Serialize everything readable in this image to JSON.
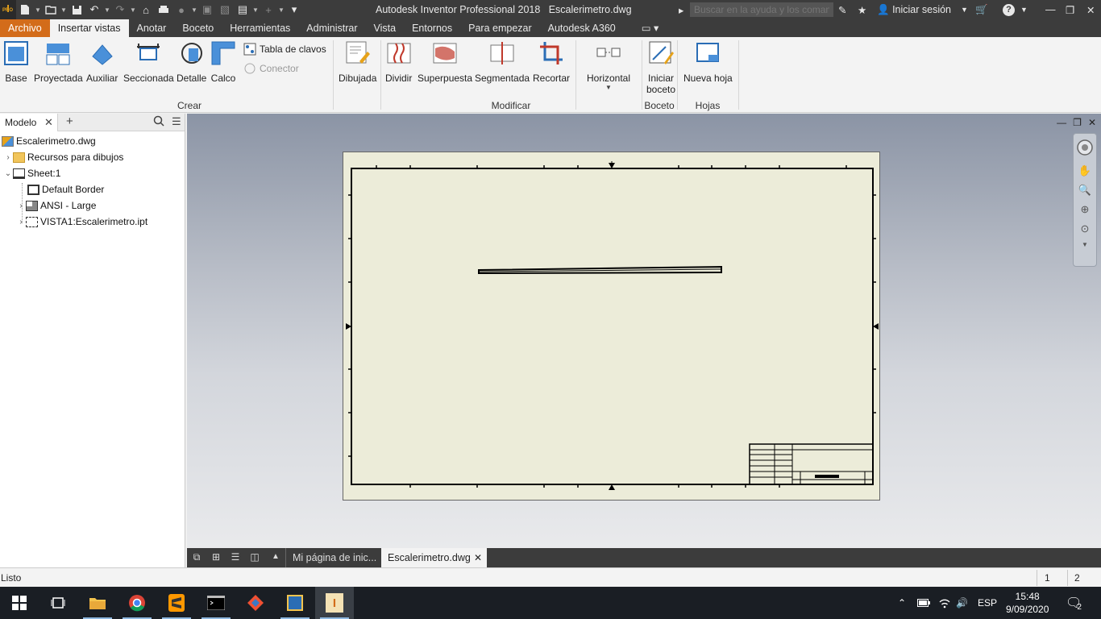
{
  "app": {
    "title": "Autodesk Inventor Professional 2018",
    "document": "Escalerimetro.dwg",
    "logo_letters": "I",
    "logo_edition": "PRO"
  },
  "titlebar": {
    "search_placeholder": "Buscar en la ayuda y los comandos",
    "signin_label": "Iniciar sesión"
  },
  "ribbon_tabs": [
    "Archivo",
    "Insertar vistas",
    "Anotar",
    "Boceto",
    "Herramientas",
    "Administrar",
    "Vista",
    "Entornos",
    "Para empezar",
    "Autodesk A360"
  ],
  "ribbon": {
    "crear": {
      "label": "Crear",
      "buttons": [
        "Base",
        "Proyectada",
        "Auxiliar",
        "Seccionada",
        "Detalle",
        "Calco"
      ],
      "small": [
        "Tabla de clavos",
        "Conector"
      ]
    },
    "modificar": {
      "label": "Modificar",
      "buttons": [
        "Dibujada",
        "Dividir",
        "Superpuesta",
        "Segmentada",
        "Recortar",
        "Horizontal"
      ]
    },
    "boceto": {
      "label": "Boceto",
      "button_line1": "Iniciar",
      "button_line2": "boceto"
    },
    "hojas": {
      "label": "Hojas",
      "button": "Nueva hoja"
    }
  },
  "browser": {
    "tab_label": "Modelo",
    "tree": [
      {
        "label": "Escalerimetro.dwg",
        "icon": "drawing-icon"
      },
      {
        "label": "Recursos para dibujos",
        "icon": "folder-icon"
      },
      {
        "label": "Sheet:1",
        "icon": "sheet-icon"
      },
      {
        "label": "Default Border",
        "icon": "border-icon"
      },
      {
        "label": "ANSI - Large",
        "icon": "titleblock-icon"
      },
      {
        "label": "VISTA1:Escalerimetro.ipt",
        "icon": "view-icon"
      }
    ]
  },
  "doc_tabs": [
    "Mi página de inic...",
    "Escalerimetro.dwg"
  ],
  "status": {
    "text": "Listo",
    "num1": "1",
    "num2": "2"
  },
  "taskbar": {
    "lang": "ESP",
    "time": "15:48",
    "date": "9/09/2020",
    "notifications": "2"
  },
  "colors": {
    "accent": "#d36c1a",
    "dark_bar": "#3c3c3c",
    "sheet": "#ececd9"
  }
}
